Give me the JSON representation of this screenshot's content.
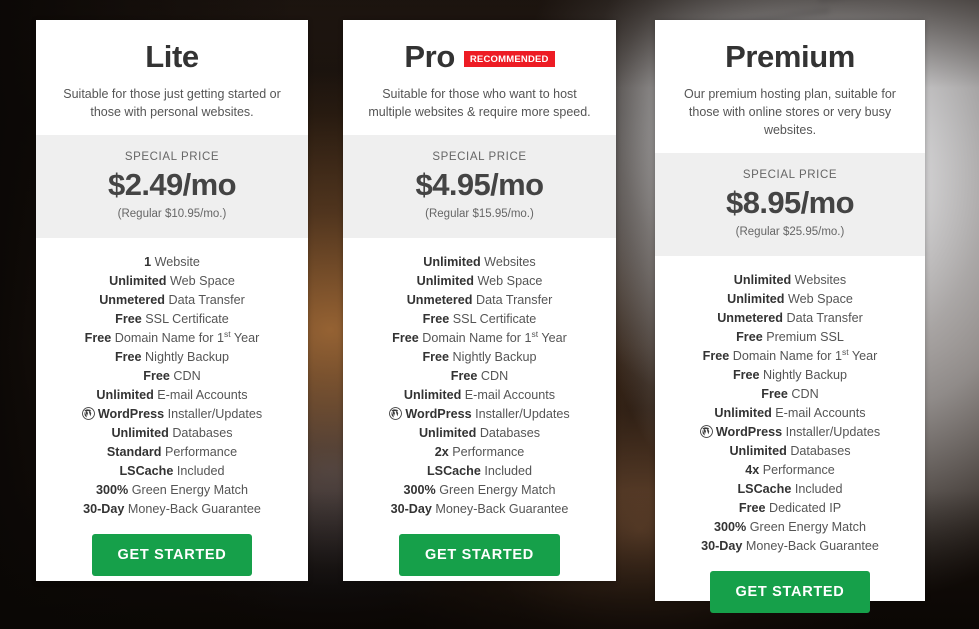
{
  "page": {
    "title": "Hosting Plan Pricing"
  },
  "plans": [
    {
      "name": "Lite",
      "badge": null,
      "description": "Suitable for those just getting started or those with personal websites.",
      "price_label": "SPECIAL PRICE",
      "price": "$2.49/mo",
      "regular_price": "(Regular $10.95/mo.)",
      "cta_label": "GET STARTED",
      "features": [
        {
          "strong": "1",
          "rest": " Website"
        },
        {
          "strong": "Unlimited",
          "rest": " Web Space"
        },
        {
          "strong": "Unmetered",
          "rest": " Data Transfer"
        },
        {
          "strong": "Free",
          "rest": " SSL Certificate"
        },
        {
          "strong": "Free",
          "rest": " Domain Name for 1st Year",
          "sup": "st"
        },
        {
          "strong": "Free",
          "rest": " Nightly Backup"
        },
        {
          "strong": "Free",
          "rest": " CDN"
        },
        {
          "strong": "Unlimited",
          "rest": " E-mail Accounts"
        },
        {
          "strong": "WordPress",
          "rest": " Installer/Updates",
          "icon": "wordpress-icon"
        },
        {
          "strong": "Unlimited",
          "rest": " Databases"
        },
        {
          "strong": "Standard",
          "rest": " Performance"
        },
        {
          "strong": "LSCache",
          "rest": " Included"
        },
        {
          "strong": "300%",
          "rest": " Green Energy Match"
        },
        {
          "strong": "30-Day",
          "rest": " Money-Back Guarantee"
        }
      ]
    },
    {
      "name": "Pro",
      "badge": "RECOMMENDED",
      "description": "Suitable for those who want to host multiple websites & require more speed.",
      "price_label": "SPECIAL PRICE",
      "price": "$4.95/mo",
      "regular_price": "(Regular $15.95/mo.)",
      "cta_label": "GET STARTED",
      "features": [
        {
          "strong": "Unlimited",
          "rest": " Websites"
        },
        {
          "strong": "Unlimited",
          "rest": " Web Space"
        },
        {
          "strong": "Unmetered",
          "rest": " Data Transfer"
        },
        {
          "strong": "Free",
          "rest": " SSL Certificate"
        },
        {
          "strong": "Free",
          "rest": " Domain Name for 1st Year",
          "sup": "st"
        },
        {
          "strong": "Free",
          "rest": " Nightly Backup"
        },
        {
          "strong": "Free",
          "rest": " CDN"
        },
        {
          "strong": "Unlimited",
          "rest": " E-mail Accounts"
        },
        {
          "strong": "WordPress",
          "rest": " Installer/Updates",
          "icon": "wordpress-icon"
        },
        {
          "strong": "Unlimited",
          "rest": " Databases"
        },
        {
          "strong": "2x",
          "rest": " Performance"
        },
        {
          "strong": "LSCache",
          "rest": " Included"
        },
        {
          "strong": "300%",
          "rest": " Green Energy Match"
        },
        {
          "strong": "30-Day",
          "rest": " Money-Back Guarantee"
        }
      ]
    },
    {
      "name": "Premium",
      "badge": null,
      "description": "Our premium hosting plan, suitable for those with online stores or very busy websites.",
      "price_label": "SPECIAL PRICE",
      "price": "$8.95/mo",
      "regular_price": "(Regular $25.95/mo.)",
      "cta_label": "GET STARTED",
      "features": [
        {
          "strong": "Unlimited",
          "rest": " Websites"
        },
        {
          "strong": "Unlimited",
          "rest": " Web Space"
        },
        {
          "strong": "Unmetered",
          "rest": " Data Transfer"
        },
        {
          "strong": "Free",
          "rest": " Premium SSL"
        },
        {
          "strong": "Free",
          "rest": " Domain Name for 1st Year",
          "sup": "st"
        },
        {
          "strong": "Free",
          "rest": " Nightly Backup"
        },
        {
          "strong": "Free",
          "rest": " CDN"
        },
        {
          "strong": "Unlimited",
          "rest": " E-mail Accounts"
        },
        {
          "strong": "WordPress",
          "rest": " Installer/Updates",
          "icon": "wordpress-icon"
        },
        {
          "strong": "Unlimited",
          "rest": " Databases"
        },
        {
          "strong": "4x",
          "rest": " Performance"
        },
        {
          "strong": "LSCache",
          "rest": " Included"
        },
        {
          "strong": "Free",
          "rest": " Dedicated IP"
        },
        {
          "strong": "300%",
          "rest": " Green Energy Match"
        },
        {
          "strong": "30-Day",
          "rest": " Money-Back Guarantee"
        }
      ]
    }
  ],
  "colors": {
    "cta_green": "#16a04a",
    "badge_red": "#ed1c24",
    "price_band": "#efefef",
    "heading": "#333333",
    "body_text": "#555555"
  }
}
